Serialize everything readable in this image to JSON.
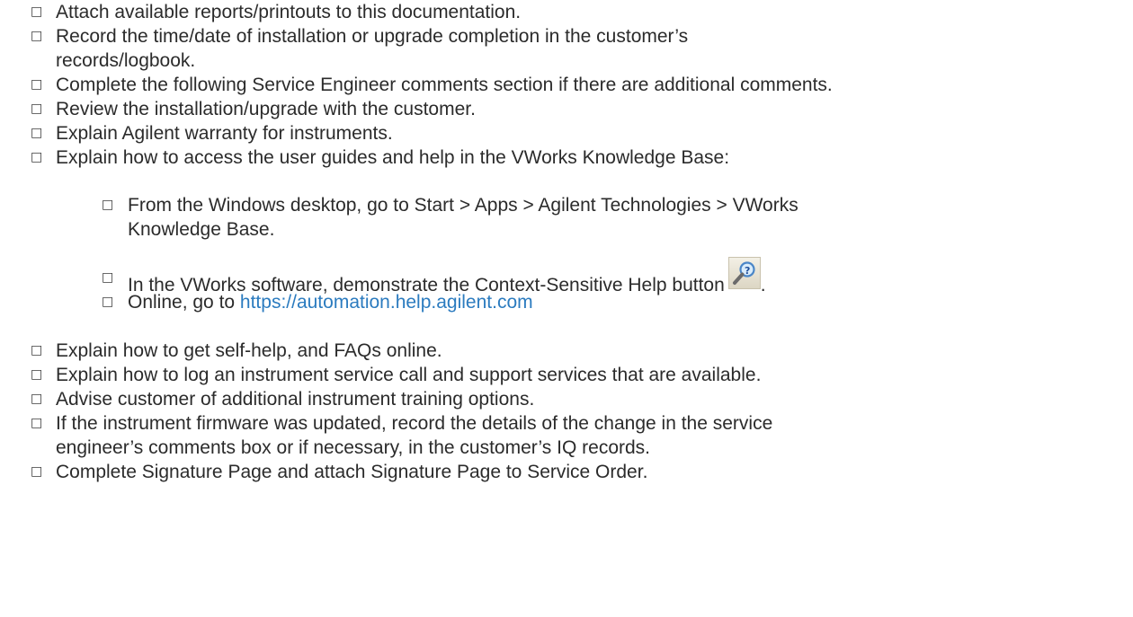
{
  "checkbox_glyph": "□",
  "items": [
    {
      "text": "Attach available reports/printouts to this documentation."
    },
    {
      "line1": "Record the time/date of installation or upgrade completion in the customer’s",
      "line2": "records/logbook."
    },
    {
      "text": "Complete the following Service Engineer comments section if there are additional comments."
    },
    {
      "text": "Review the installation/upgrade with the customer."
    },
    {
      "text": "Explain Agilent warranty for instruments."
    },
    {
      "text": "Explain how to access the user guides and help in the VWorks Knowledge Base:"
    },
    {
      "text": "Explain how to get self-help, and FAQs online."
    },
    {
      "text": "Explain how to log an instrument service call and support services that are available."
    },
    {
      "text": "Advise customer of additional instrument training options."
    },
    {
      "line1": "If the instrument firmware was updated, record the details of the change in the service",
      "line2": "engineer’s comments box or if necessary, in the customer’s IQ records."
    },
    {
      "text": "Complete Signature Page and attach Signature Page to Service Order."
    }
  ],
  "subitems": [
    {
      "line1": "From the Windows desktop, go to Start > Apps > Agilent Technologies > VWorks",
      "line2": "Knowledge Base."
    },
    {
      "text": "In the VWorks software, demonstrate the Context-Sensitive Help button",
      "icon": "context-sensitive-help-icon",
      "trailing": "."
    },
    {
      "text": "Online, go to ",
      "link": "https://automation.help.agilent.com"
    }
  ]
}
